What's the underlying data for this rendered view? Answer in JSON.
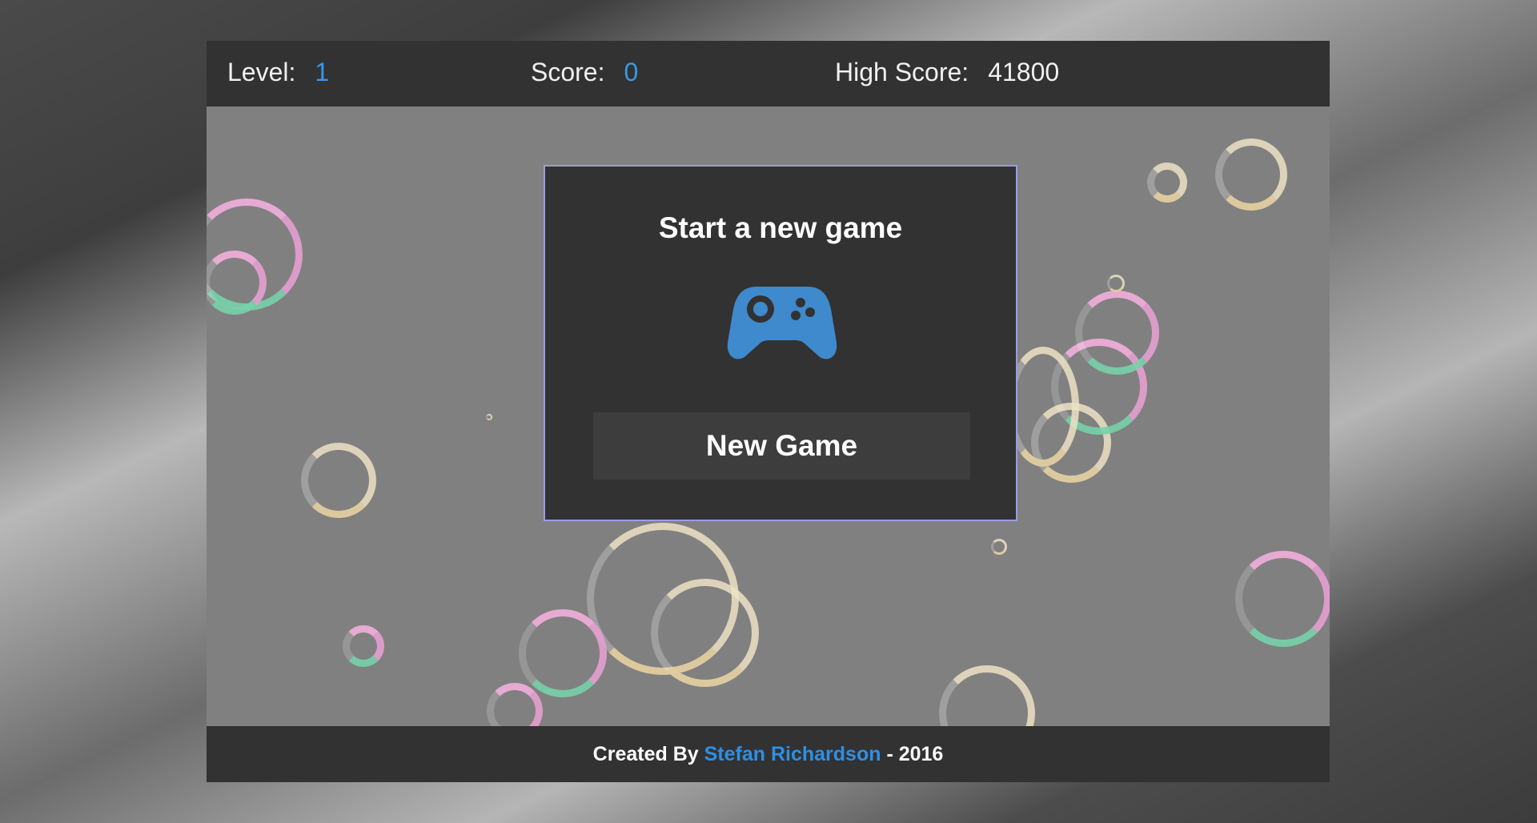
{
  "scorebar": {
    "level_label": "Level:",
    "level_value": "1",
    "score_label": "Score:",
    "score_value": "0",
    "high_score_label": "High Score:",
    "high_score_value": "41800"
  },
  "dialog": {
    "title": "Start a new game",
    "icon": "gamepad-icon",
    "button_label": "New Game"
  },
  "footer": {
    "prefix": "Created By",
    "author": "Stefan Richardson",
    "suffix": "- 2016"
  },
  "colors": {
    "accent_blue": "#3b97e8",
    "bar_bg": "#323232",
    "dialog_border": "#9a9ae8",
    "playfield_bg": "#808080"
  }
}
